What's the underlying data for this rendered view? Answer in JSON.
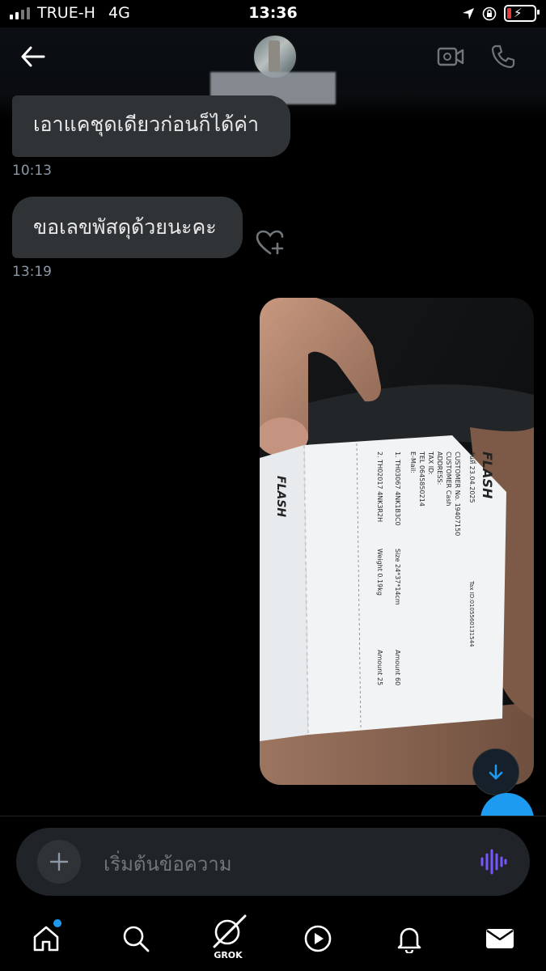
{
  "status_bar": {
    "carrier": "TRUE-H",
    "network": "4G",
    "time": "13:36"
  },
  "header": {
    "back_icon": "arrow-left-icon",
    "video_icon": "video-call-icon",
    "phone_icon": "phone-icon"
  },
  "messages": [
    {
      "text": "เอาแคชุดเดียวก่อนก็ได้ค่า",
      "time": "10:13"
    },
    {
      "text": "ขอเลขพัสดุด้วยนะคะ",
      "time": "13:19"
    }
  ],
  "receipt": {
    "brand": "FLASH",
    "date": "วันที่ 23.04.2025",
    "customer_no": "CUSTOMER No. 19407150",
    "customer": "CUSTOMER Cash",
    "address": "ADDRESS:",
    "tax_id": "TAX ID:",
    "tel": "TEL 0645850214",
    "email": "E-Mail:",
    "item1": "1. TH03067 4NK1B3C0",
    "item2": "2. TH02017 4NK3R2H",
    "size": "Size 24*37*14cm",
    "weight": "Weight 0.19kg",
    "amount1": "Amount 60",
    "amount2": "Amount 25",
    "company_tax": "Tax ID:0105560131544"
  },
  "composer": {
    "placeholder": "เริ่มต้นข้อความ"
  },
  "nav": {
    "grok_label": "GROK"
  },
  "colors": {
    "accent": "#1d9bf0",
    "bubble": "#2f3336",
    "voice": "#7856ff"
  }
}
